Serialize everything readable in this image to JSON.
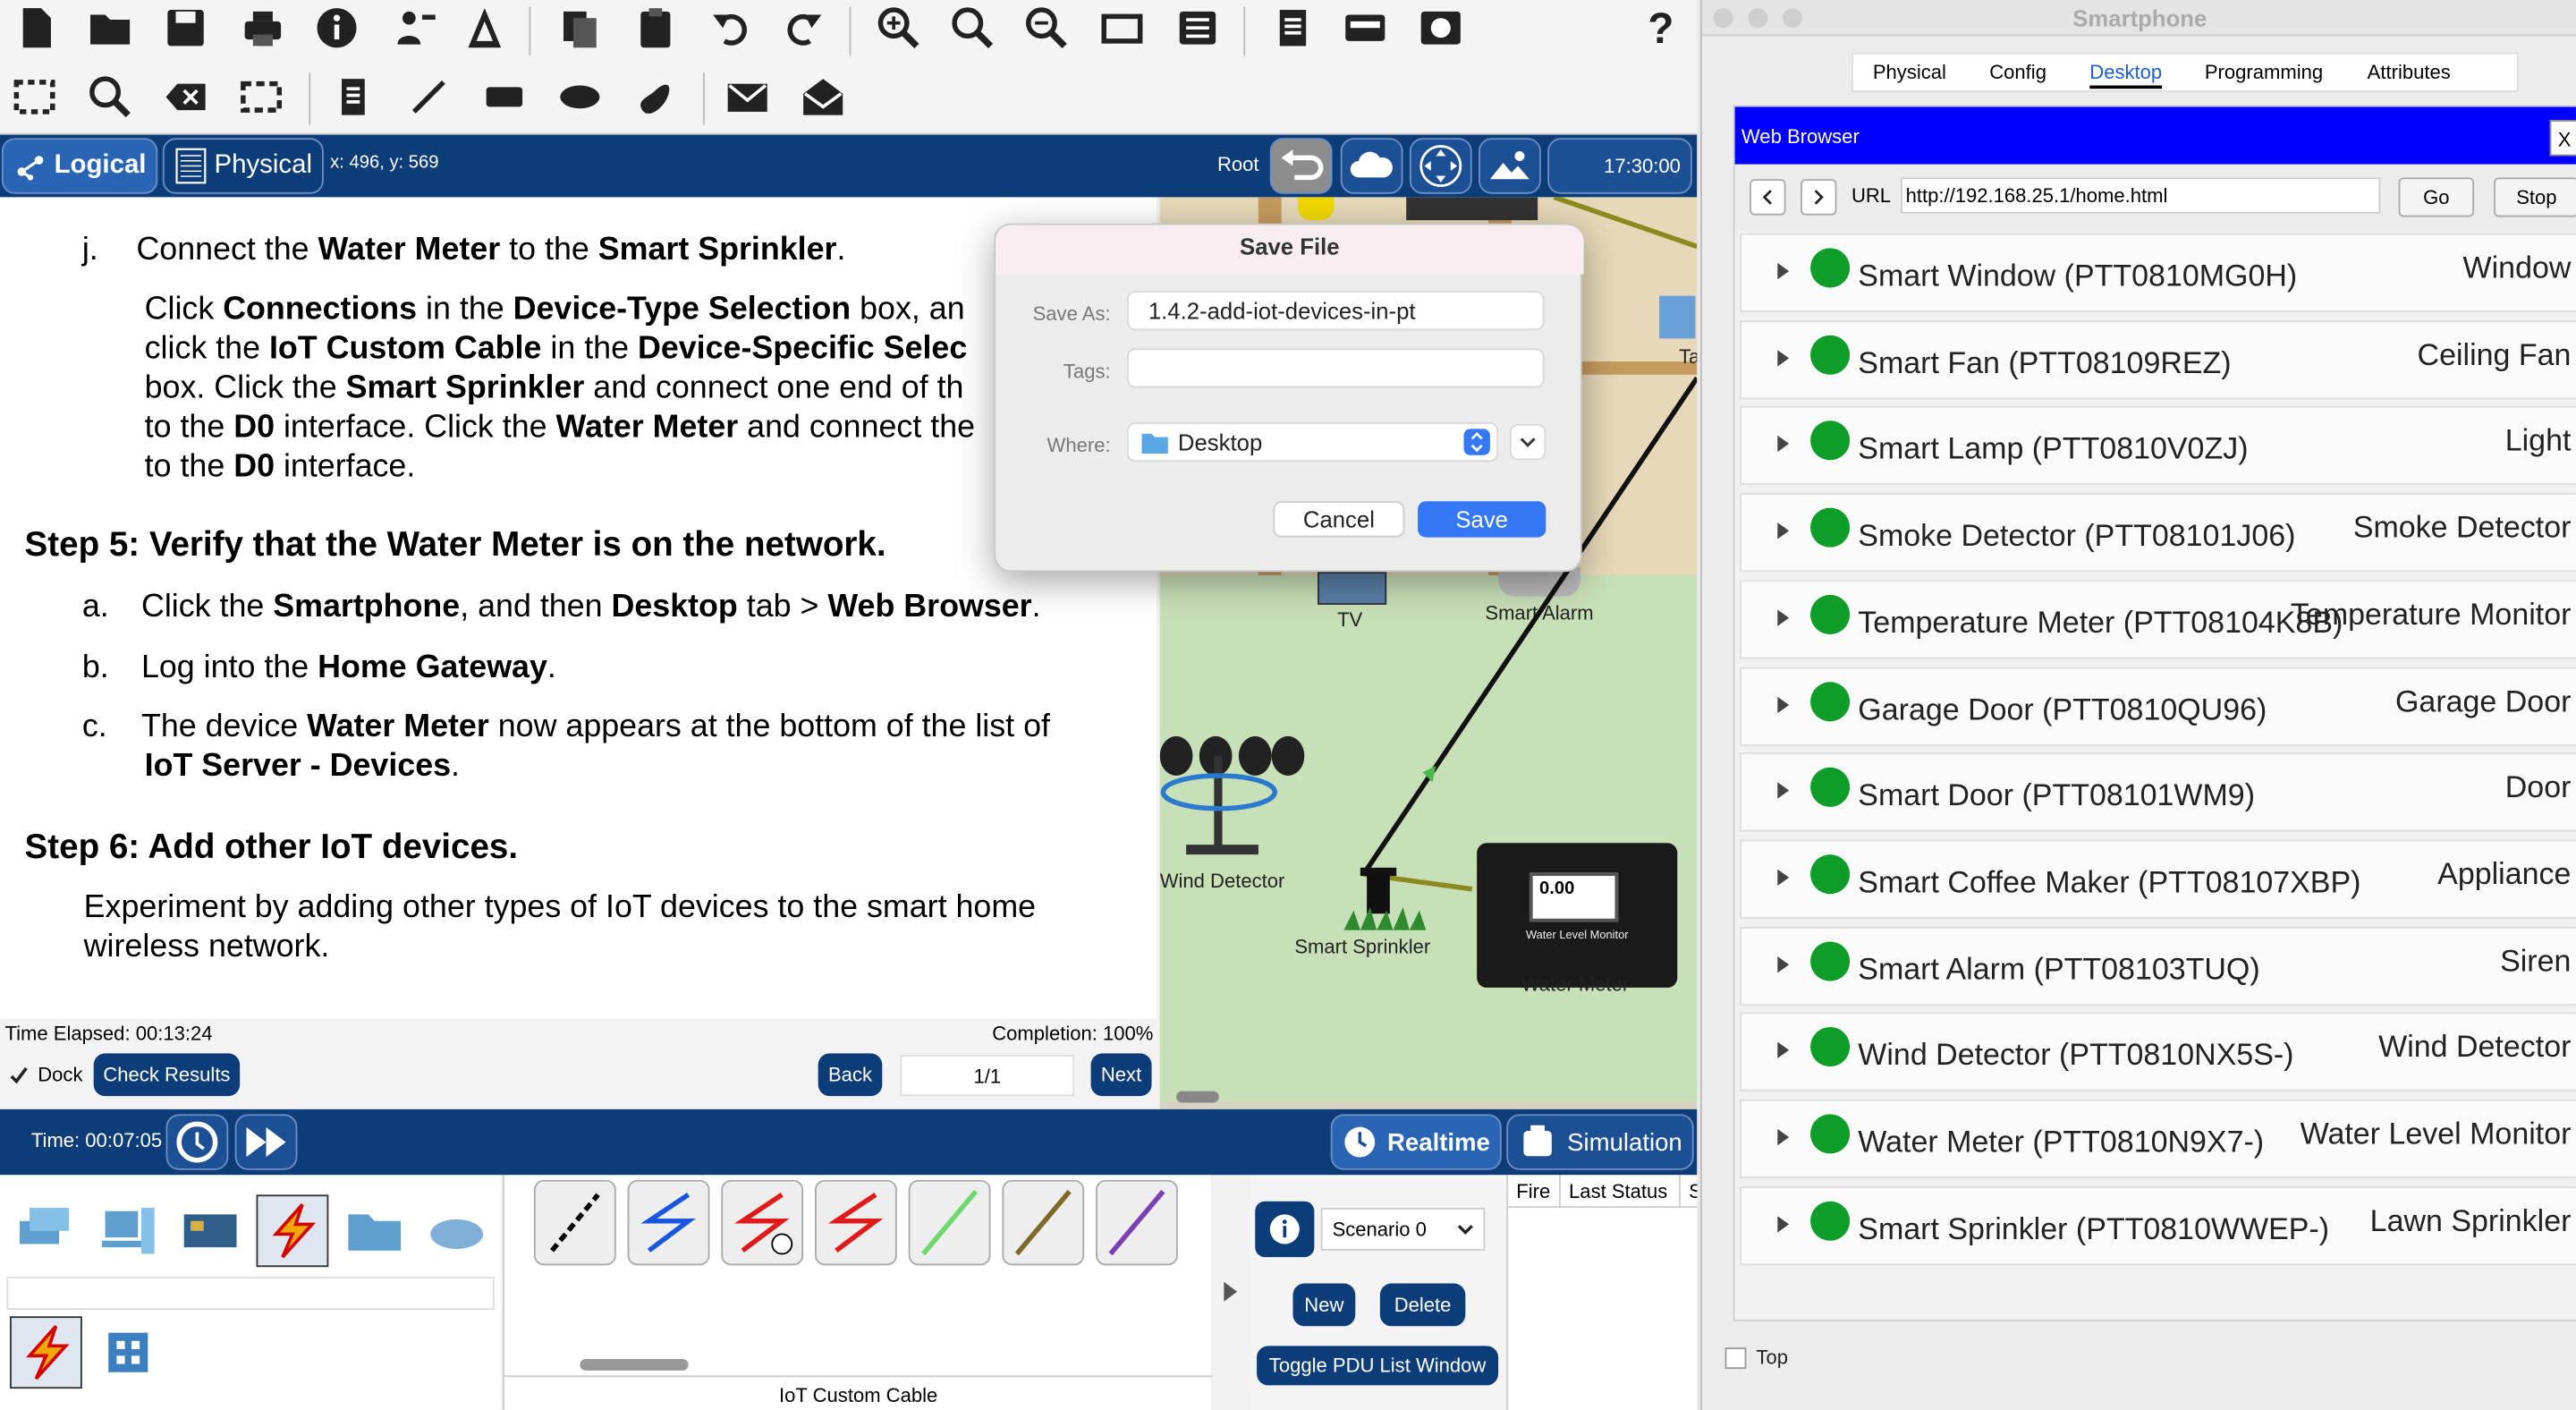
{
  "toolbar": {
    "row1_icons": [
      "new-file-icon",
      "open-folder-icon",
      "save-icon",
      "print-icon",
      "info-icon",
      "activity-wizard-icon",
      "activity-icon",
      "copy-icon",
      "paste-icon",
      "undo-icon",
      "redo-icon",
      "zoom-in-icon",
      "zoom-reset-icon",
      "zoom-out-icon",
      "drawing-palette-icon",
      "custom-device-icon",
      "notes-icon",
      "workspace-list-icon",
      "cloud-icon",
      "help-icon"
    ],
    "help_label": "?"
  },
  "nav": {
    "logical": "Logical",
    "physical": "Physical",
    "coord": "x: 496, y: 569",
    "root": "Root",
    "clock": "17:30:00"
  },
  "instructions": {
    "j_marker": "j.",
    "j_text_parts": [
      "Connect the ",
      "Water Meter",
      " to the ",
      "Smart Sprinkler",
      "."
    ],
    "para_lines": [
      [
        "Click ",
        "Connections",
        " in the ",
        "Device-Type Selection",
        " box, an"
      ],
      [
        "click the ",
        "IoT Custom Cable",
        " in the ",
        "Device-Specific Selec"
      ],
      [
        "box. Click the ",
        "Smart Sprinkler",
        " and connect one end of th"
      ],
      [
        "to the ",
        "D0",
        " interface. Click the ",
        "Water Meter",
        " and connect the"
      ],
      [
        "to the ",
        "D0",
        " interface."
      ]
    ],
    "step5": "Step 5: Verify that the Water Meter is on the network.",
    "step5_items": [
      {
        "marker": "a.",
        "parts": [
          "Click the ",
          "Smartphone",
          ", and then ",
          "Desktop",
          " tab > ",
          "Web Browser",
          "."
        ]
      },
      {
        "marker": "b.",
        "parts": [
          "Log into the ",
          "Home Gateway",
          "."
        ]
      },
      {
        "marker": "c.",
        "parts": [
          "The device ",
          "Water Meter",
          " now appears at the bottom of the list of"
        ]
      }
    ],
    "step5_c_cont": [
      "IoT Server - Devices",
      "."
    ],
    "step6": "Step 6: Add other IoT devices.",
    "step6_lines": [
      "Experiment by adding other types of IoT devices to the smart home",
      "wireless network."
    ]
  },
  "status": {
    "time_elapsed": "Time Elapsed: 00:13:24",
    "completion": "Completion: 100%",
    "dock_label": "Dock",
    "check_results": "Check Results",
    "back": "Back",
    "page": "1/1",
    "next": "Next"
  },
  "workspace": {
    "labels": {
      "tv": "TV",
      "smart_alarm": "Smart Alarm",
      "wind_detector": "Wind Detector",
      "smart_sprinkler": "Smart Sprinkler",
      "water_meter": "Water Meter",
      "ta": "Ta"
    },
    "meter_value": "0.00",
    "meter_caption": "Water Level Monitor"
  },
  "bottom": {
    "time": "Time: 00:07:05",
    "realtime": "Realtime",
    "simulation": "Simulation",
    "cable_label": "IoT Custom Cable",
    "scenario": "Scenario 0",
    "new": "New",
    "delete": "Delete",
    "toggle_pdu": "Toggle PDU List Window",
    "col_fire": "Fire",
    "col_last_status": "Last Status",
    "col_s": "S"
  },
  "save_dialog": {
    "title": "Save File",
    "save_as_label": "Save As:",
    "save_as_value": "1.4.2-add-iot-devices-in-pt",
    "tags_label": "Tags:",
    "where_label": "Where:",
    "where_value": "Desktop",
    "cancel": "Cancel",
    "save": "Save"
  },
  "phone": {
    "title": "Smartphone",
    "tabs": [
      "Physical",
      "Config",
      "Desktop",
      "Programming",
      "Attributes"
    ],
    "selected_tab": "Desktop",
    "browser_title": "Web Browser",
    "close": "X",
    "url_label": "URL",
    "url": "http://192.168.25.1/home.html",
    "go": "Go",
    "stop": "Stop",
    "top_checkbox": "Top",
    "devices": [
      {
        "name": "Smart Window (PTT0810MG0H)",
        "type": "Window"
      },
      {
        "name": "Smart Fan (PTT08109REZ)",
        "type": "Ceiling Fan"
      },
      {
        "name": "Smart Lamp (PTT0810V0ZJ)",
        "type": "Light"
      },
      {
        "name": "Smoke Detector (PTT08101J06)",
        "type": "Smoke Detector"
      },
      {
        "name": "Temperature Meter (PTT08104K8B)",
        "type": "Temperature Monitor"
      },
      {
        "name": "Garage Door (PTT0810QU96)",
        "type": "Garage Door"
      },
      {
        "name": "Smart Door (PTT08101WM9)",
        "type": "Door"
      },
      {
        "name": "Smart Coffee Maker (PTT08107XBP)",
        "type": "Appliance"
      },
      {
        "name": "Smart Alarm (PTT08103TUQ)",
        "type": "Siren"
      },
      {
        "name": "Wind Detector (PTT0810NX5S-)",
        "type": "Wind Detector"
      },
      {
        "name": "Water Meter (PTT0810N9X7-)",
        "type": "Water Level Monitor"
      },
      {
        "name": "Smart Sprinkler (PTT0810WWEP-)",
        "type": "Lawn Sprinkler"
      }
    ],
    "status_color": "#0f9d2a"
  }
}
